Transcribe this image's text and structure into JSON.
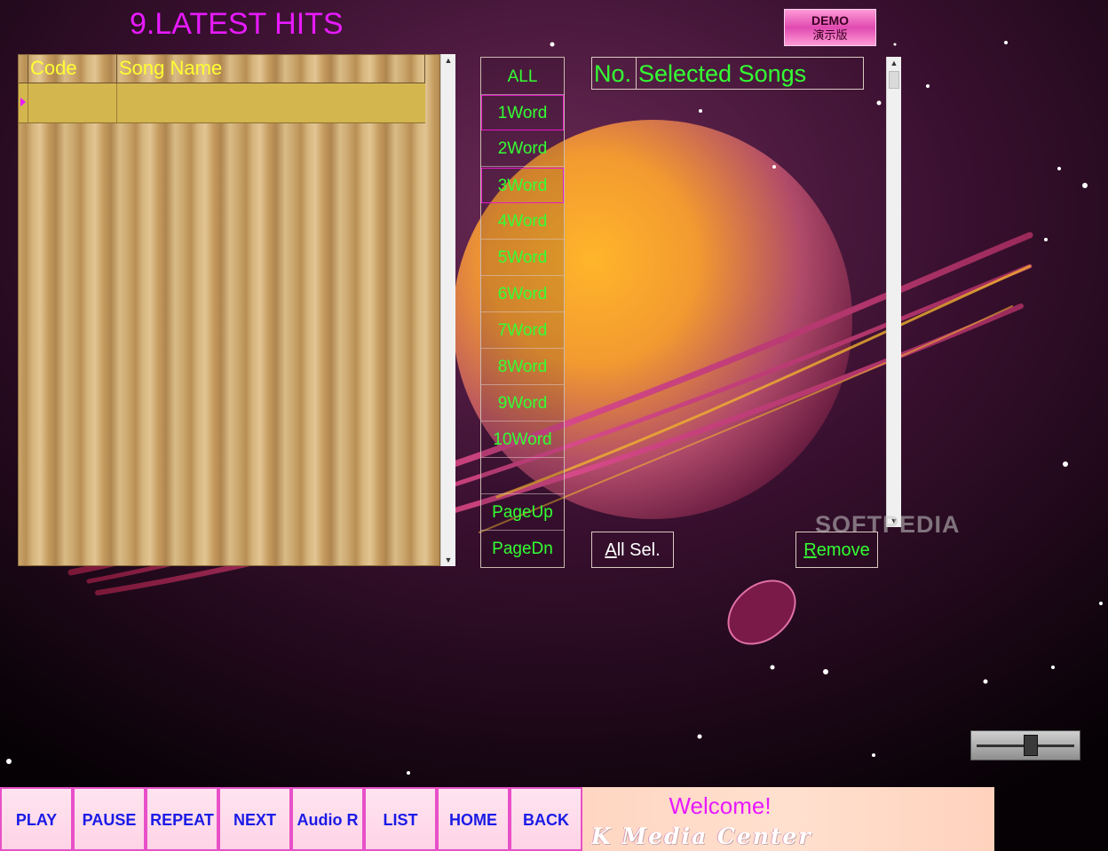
{
  "title": "9.LATEST HITS",
  "demo_badge": {
    "line1": "DEMO",
    "line2": "演示版"
  },
  "song_grid": {
    "columns": [
      "Code",
      "Song Name"
    ],
    "rows": [
      {
        "code": "",
        "name": ""
      }
    ]
  },
  "filters": [
    "ALL",
    "1Word",
    "2Word",
    "3Word",
    "4Word",
    "5Word",
    "6Word",
    "7Word",
    "8Word",
    "9Word",
    "10Word",
    "",
    "PageUp",
    "PageDn"
  ],
  "selected_songs": {
    "col_no": "No.",
    "col_name": "Selected Songs"
  },
  "actions": {
    "all_sel_u": "A",
    "all_sel_rest": "ll Sel.",
    "remove_u": "R",
    "remove_rest": "emove"
  },
  "watermark": "SOFTPEDIA",
  "volume": {
    "level": 0.55
  },
  "nav": [
    "PLAY",
    "PAUSE",
    "REPEAT",
    "NEXT",
    "Audio R",
    "LIST",
    "HOME",
    "BACK"
  ],
  "welcome": "Welcome!",
  "brand": "K Media Center",
  "colors": {
    "title": "#e81aff",
    "filter_text": "#33ff33",
    "nav_text": "#1a1ae6",
    "nav_border": "#e850c8"
  }
}
